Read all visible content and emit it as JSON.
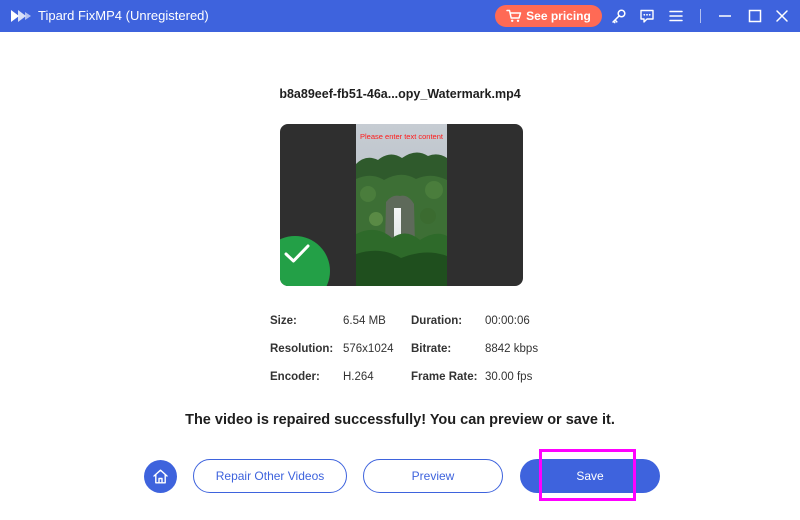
{
  "window": {
    "title": "Tipard FixMP4 (Unregistered)",
    "pricing_label": "See pricing",
    "accent_color": "#3e63dd",
    "pricing_color": "#ff6a55",
    "icons": [
      "app-logo-icon",
      "cart-icon",
      "key-icon",
      "feedback-icon",
      "menu-icon",
      "minimize-icon",
      "maximize-icon",
      "close-icon"
    ]
  },
  "result": {
    "filename": "b8a89eef-fb51-46a...opy_Watermark.mp4",
    "watermark_text": "Please enter text content",
    "success_message": "The video is repaired successfully! You can preview or save it."
  },
  "info": {
    "size_label": "Size:",
    "size_value": "6.54 MB",
    "duration_label": "Duration:",
    "duration_value": "00:00:06",
    "resolution_label": "Resolution:",
    "resolution_value": "576x1024",
    "bitrate_label": "Bitrate:",
    "bitrate_value": "8842 kbps",
    "encoder_label": "Encoder:",
    "encoder_value": "H.264",
    "framerate_label": "Frame Rate:",
    "framerate_value": "30.00 fps"
  },
  "actions": {
    "repair_label": "Repair Other Videos",
    "preview_label": "Preview",
    "save_label": "Save",
    "highlight_color": "#ff00ff"
  }
}
